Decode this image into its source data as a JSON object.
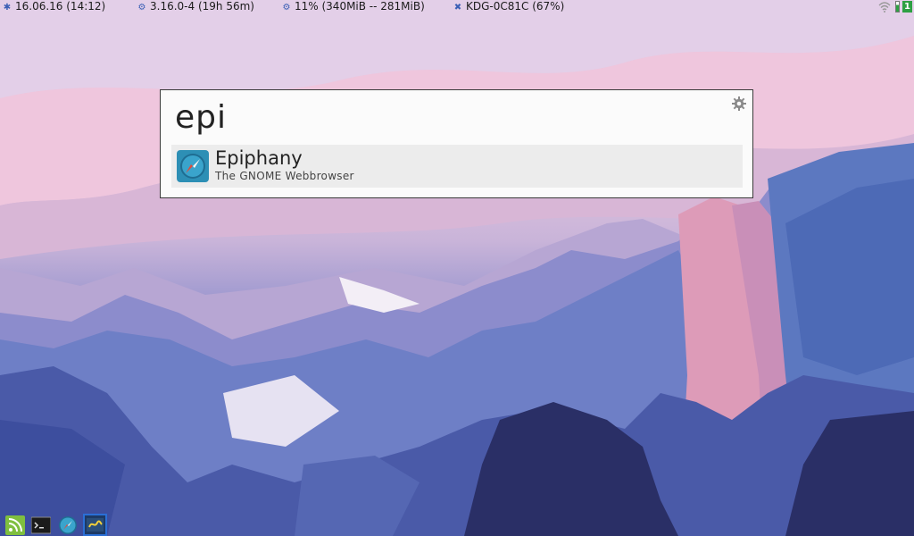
{
  "topbar": {
    "date": "16.06.16 (14:12)",
    "kernel": "3.16.0-4 (19h 56m)",
    "memory": "11% (340MiB -- 281MiB)",
    "network": "KDG-0C81C (67%)",
    "workspace": "1",
    "date_icon": "star-icon",
    "kernel_icon": "gear-icon",
    "memory_icon": "gear-icon",
    "network_icon": "tools-icon"
  },
  "launcher": {
    "query": "epi",
    "results": [
      {
        "name": "Epiphany",
        "description": "The GNOME Webbrowser",
        "icon": "compass-icon"
      }
    ]
  },
  "dock": {
    "items": [
      {
        "icon": "rss-feed-icon"
      },
      {
        "icon": "terminal-icon"
      },
      {
        "icon": "compass-icon"
      },
      {
        "icon": "app-switcher-icon"
      }
    ]
  },
  "colors": {
    "accent": "#2ea043",
    "selection": "#ececec",
    "dock_highlight": "#2b6fd6"
  }
}
